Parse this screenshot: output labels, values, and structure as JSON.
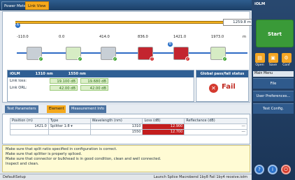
{
  "top_tabs": [
    "Power Meter",
    "Link View"
  ],
  "link_view": {
    "distance_label": "1259.8 m",
    "ticks": [
      "-110.0",
      "0.0",
      "414.0",
      "836.0",
      "1421.0",
      "1973.0",
      "m"
    ],
    "marker_a": "A",
    "marker_b": "B",
    "element_badges": [
      "✓",
      "✓",
      "✓",
      "!",
      "✓",
      "✓"
    ]
  },
  "results": {
    "title": "iOLM",
    "wl1": "1310 nm",
    "wl2": "1550 nm",
    "rows": [
      {
        "label": "Link loss:",
        "v1": "19.100 dB",
        "v2": "19.680 dB"
      },
      {
        "label": "Link ORL:",
        "v1": "42.00 dB",
        "v2": "42.00 dB"
      }
    ]
  },
  "status": {
    "title": "Global pass/fail status",
    "result": "Fail",
    "icon": "close-icon"
  },
  "lower_tabs": [
    "Test Parameters",
    "Element",
    "Measurement Info"
  ],
  "element_table": {
    "headers": [
      "Position (m)",
      "Type",
      "Wavelength (nm)",
      "Loss (dB)",
      "Reflectance (dB)"
    ],
    "rows": [
      {
        "position": "1421.0",
        "type": "Splitter 1:8",
        "wavelength": "1310",
        "loss": "12.900",
        "reflectance": "---"
      },
      {
        "position": "",
        "type": "",
        "wavelength": "1550",
        "loss": "12.700",
        "reflectance": "---"
      }
    ]
  },
  "messages": [
    "Make sure that split ratio specified in configuration is correct.",
    "Make sure that splitter is properly spliced.",
    "Make sure that connector or bulkhead is in good condition, clean and well connected.",
    "Inspect and clean."
  ],
  "footer": {
    "left": "DefaultSetup",
    "right": "Launch Splice Macrobend 1by8 Fail 1by4 receive.iolm"
  },
  "right_panel": {
    "title": "iOLM",
    "start": "Start",
    "icons": [
      {
        "label": "Open",
        "icon": "folder-icon"
      },
      {
        "label": "Save",
        "icon": "save-icon"
      },
      {
        "label": "Conf",
        "icon": "config-icon"
      }
    ],
    "main_menu": "Main Menu",
    "menu": [
      "File",
      "User Preferences...",
      "Test Config."
    ],
    "bottom_icons": [
      "help-icon",
      "info-icon",
      "power-icon"
    ]
  },
  "colors": {
    "accent": "#f4a81b",
    "primary": "#2f5f94",
    "fail": "#c31d1d",
    "pass": "#3ea52d"
  }
}
